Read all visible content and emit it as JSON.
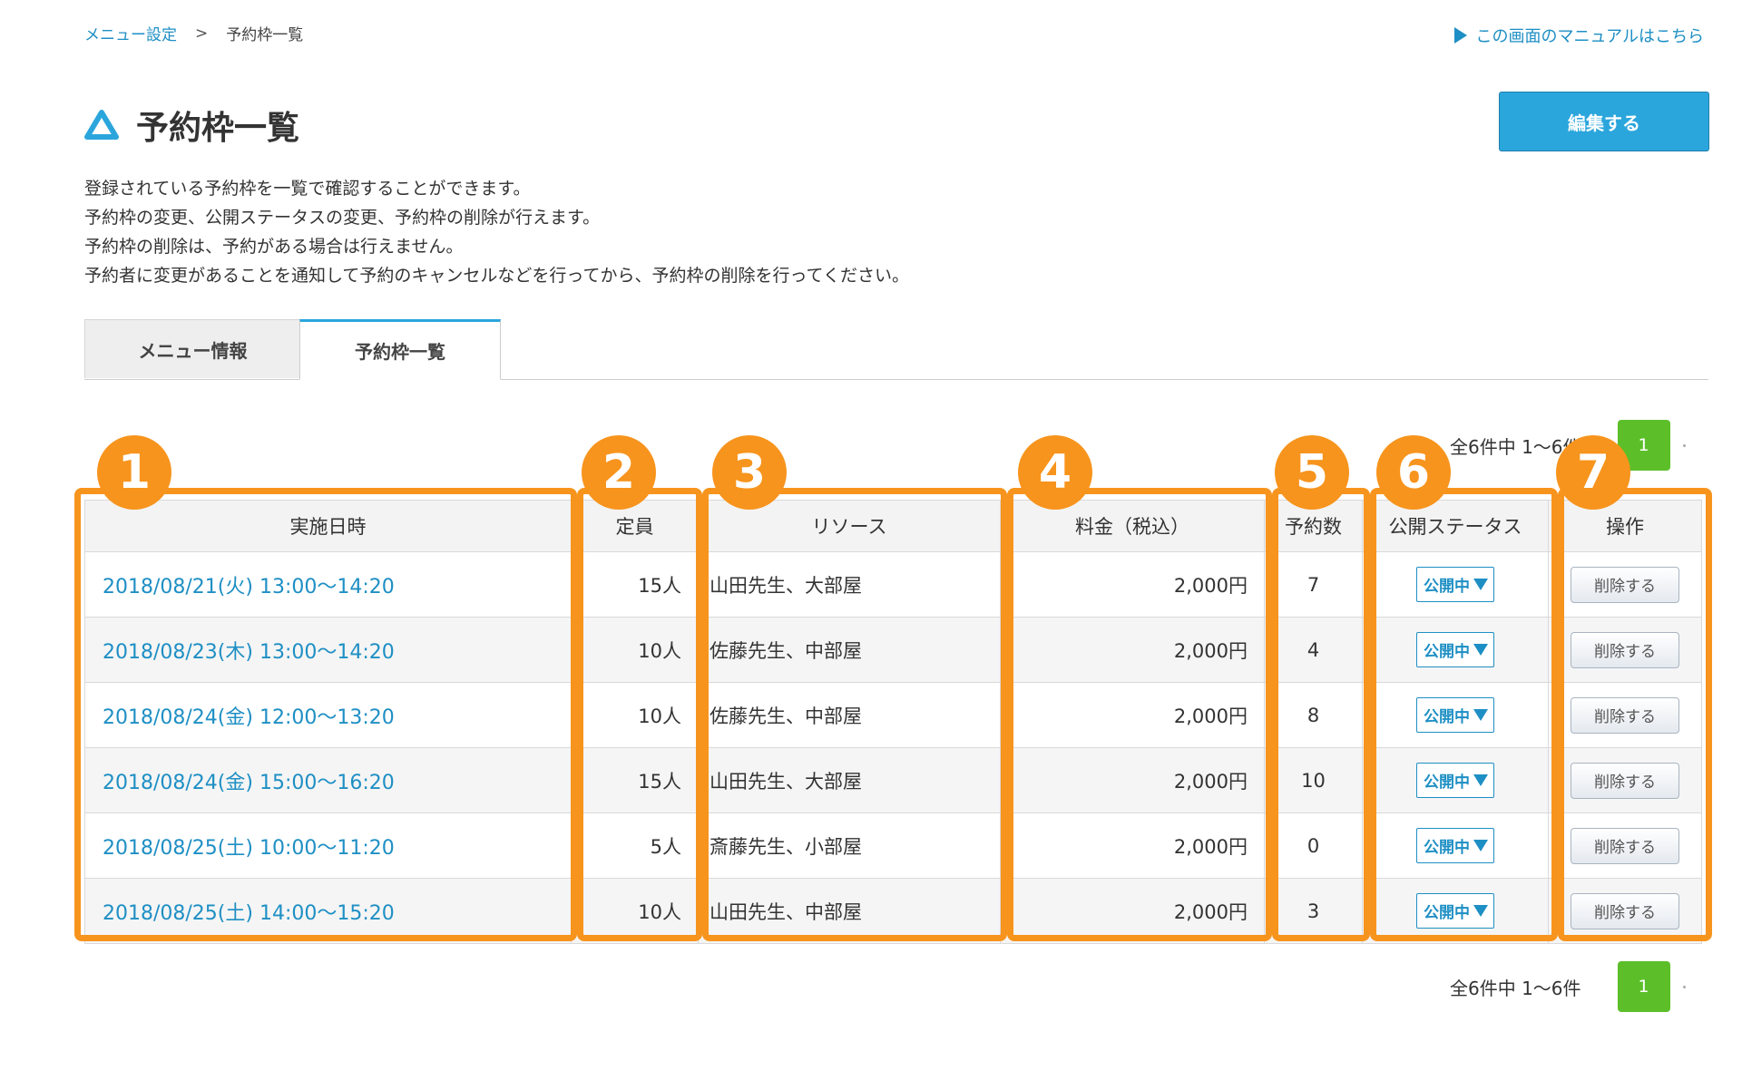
{
  "breadcrumb": {
    "parent": "メニュー設定",
    "separator": ">",
    "current": "予約枠一覧"
  },
  "manual_link": "この画面のマニュアルはこちら",
  "page_title": "予約枠一覧",
  "edit_button": "編集する",
  "description": [
    "登録されている予約枠を一覧で確認することができます。",
    "予約枠の変更、公開ステータスの変更、予約枠の削除が行えます。",
    "予約枠の削除は、予約がある場合は行えません。",
    "予約者に変更があることを通知して予約のキャンセルなどを行ってから、予約枠の削除を行ってください。"
  ],
  "tabs": [
    {
      "label": "メニュー情報"
    },
    {
      "label": "予約枠一覧"
    }
  ],
  "pagination": {
    "count_text": "全6件中 1〜6件",
    "current_page": "1"
  },
  "table": {
    "headers": [
      "実施日時",
      "定員",
      "リソース",
      "料金（税込）",
      "予約数",
      "公開ステータス",
      "操作"
    ],
    "rows": [
      {
        "datetime": "2018/08/21(火) 13:00〜14:20",
        "capacity": "15人",
        "resource": "山田先生、大部屋",
        "price": "2,000円",
        "bookings": "7",
        "status": "公開中",
        "action": "削除する"
      },
      {
        "datetime": "2018/08/23(木) 13:00〜14:20",
        "capacity": "10人",
        "resource": "佐藤先生、中部屋",
        "price": "2,000円",
        "bookings": "4",
        "status": "公開中",
        "action": "削除する"
      },
      {
        "datetime": "2018/08/24(金) 12:00〜13:20",
        "capacity": "10人",
        "resource": "佐藤先生、中部屋",
        "price": "2,000円",
        "bookings": "8",
        "status": "公開中",
        "action": "削除する"
      },
      {
        "datetime": "2018/08/24(金) 15:00〜16:20",
        "capacity": "15人",
        "resource": "山田先生、大部屋",
        "price": "2,000円",
        "bookings": "10",
        "status": "公開中",
        "action": "削除する"
      },
      {
        "datetime": "2018/08/25(土) 10:00〜11:20",
        "capacity": "5人",
        "resource": "斎藤先生、小部屋",
        "price": "2,000円",
        "bookings": "0",
        "status": "公開中",
        "action": "削除する"
      },
      {
        "datetime": "2018/08/25(土) 14:00〜15:20",
        "capacity": "10人",
        "resource": "山田先生、中部屋",
        "price": "2,000円",
        "bookings": "3",
        "status": "公開中",
        "action": "削除する"
      }
    ]
  },
  "callouts": [
    "1",
    "2",
    "3",
    "4",
    "5",
    "6",
    "7"
  ],
  "colors": {
    "accent": "#2ba6dc",
    "link": "#1e8fc4",
    "callout": "#f7941d",
    "page_button": "#5cbf2a"
  },
  "icons": {
    "title": "triangle-logo-icon",
    "manual": "play-triangle-icon",
    "status_dropdown": "caret-down-icon"
  }
}
